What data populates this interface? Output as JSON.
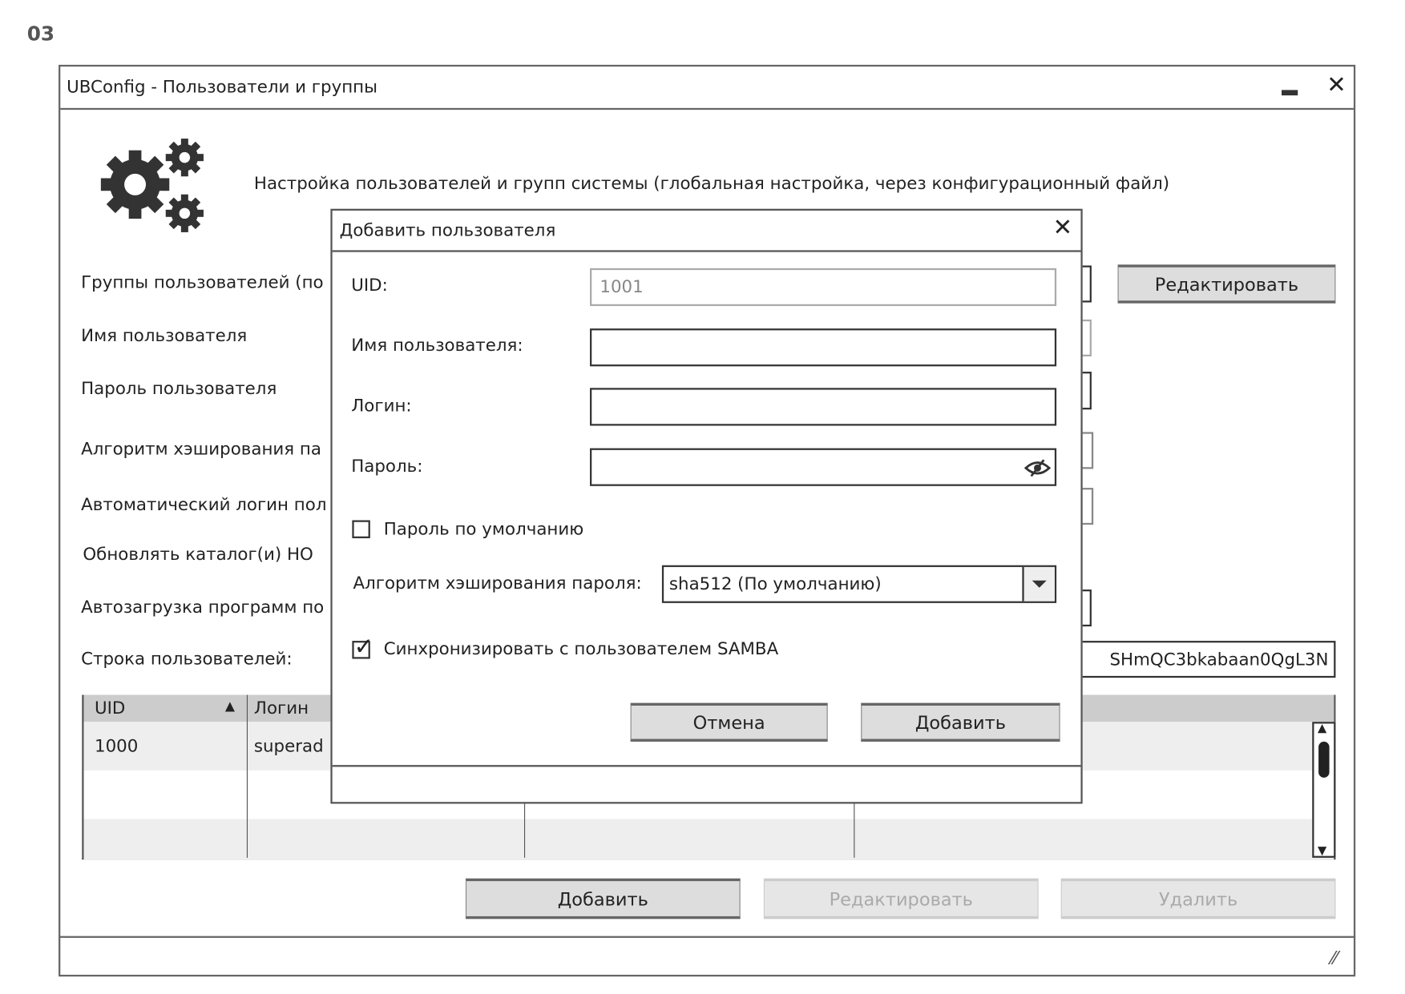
{
  "page_label": "03",
  "window": {
    "title": "UBConfig - Пользователи и группы",
    "description": "Настройка пользователей и групп системы (глобальная настройка, через конфигурационный файл)",
    "labels": [
      "Группы пользователей (по",
      "Имя пользователя",
      "Пароль пользователя",
      "Алгоритм хэширования па",
      "Автоматический логин пол",
      "Обновлять каталог(и) HO",
      "Автозагрузка программ по",
      "Строка пользователей:"
    ],
    "edit_groups_button": "Редактировать",
    "users_string_value": "SHmQC3bkabaan0QgL3N",
    "table": {
      "headers": [
        "UID",
        "Логин"
      ],
      "rows": [
        [
          "1000",
          "superad"
        ]
      ]
    },
    "buttons": {
      "add": "Добавить",
      "edit": "Редактировать",
      "delete": "Удалить"
    }
  },
  "dialog": {
    "title": "Добавить пользователя",
    "uid_label": "UID:",
    "uid_value": "1001",
    "username_label": "Имя пользователя:",
    "username_value": "",
    "login_label": "Логин:",
    "login_value": "",
    "password_label": "Пароль:",
    "password_value": "",
    "default_password_label": "Пароль по умолчанию",
    "default_password_checked": false,
    "hash_label": "Алгоритм хэширования пароля:",
    "hash_value": "sha512 (По умолчанию)",
    "samba_label": "Синхронизировать с пользователем SAMBA",
    "samba_checked": true,
    "cancel_button": "Отмена",
    "add_button": "Добавить"
  }
}
